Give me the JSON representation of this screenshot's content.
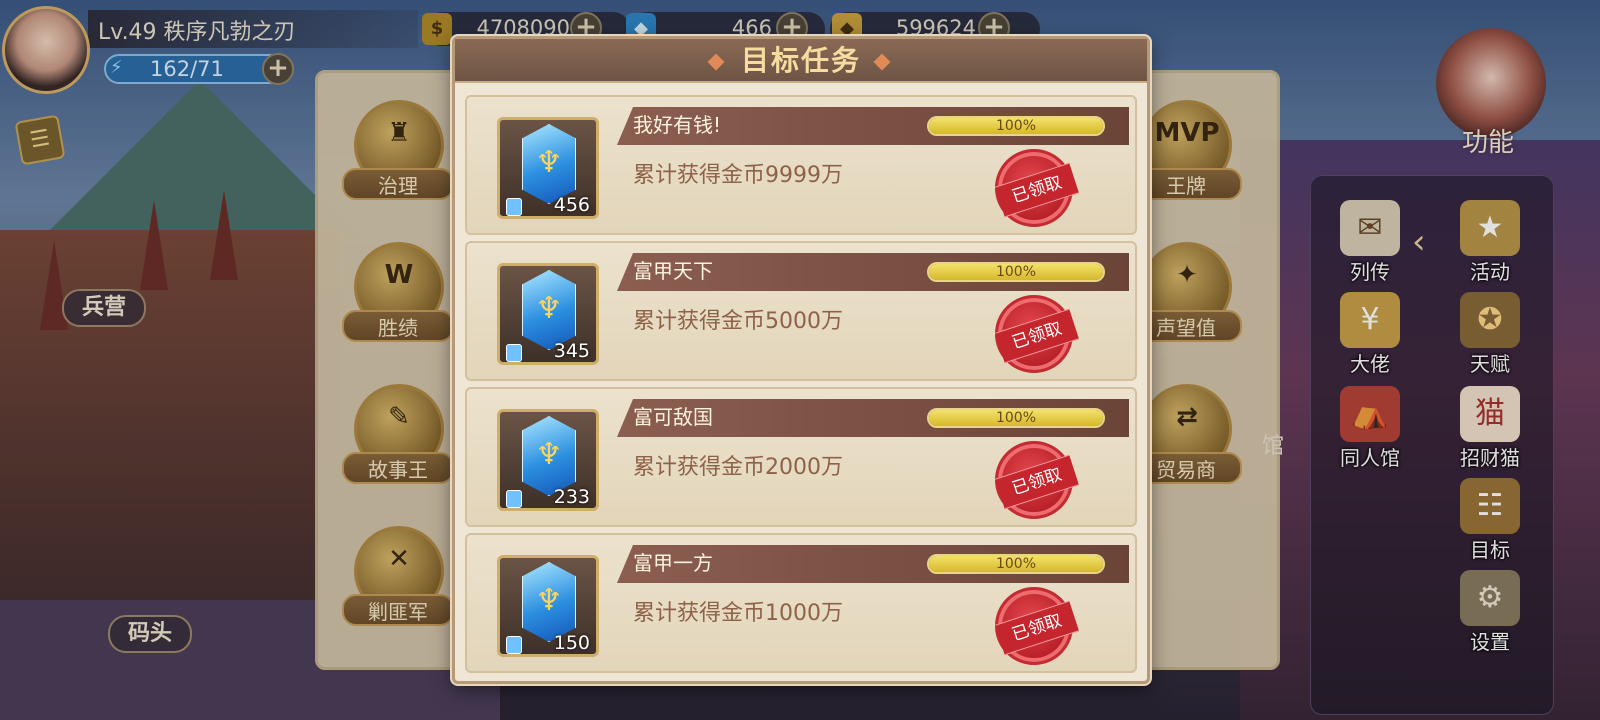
{
  "player": {
    "level_name": "Lv.49  秩序凡勃之刃",
    "energy": "162/71"
  },
  "resources": [
    {
      "icon": "gold-coin-icon",
      "value": "4708090"
    },
    {
      "icon": "blue-ticket-icon",
      "value": "466"
    },
    {
      "icon": "gold-ticket-icon",
      "value": "599624"
    }
  ],
  "places": {
    "barracks": "兵营",
    "dock": "码头"
  },
  "left_menu": [
    "治理",
    "胜绩",
    "故事王",
    "剿匪军"
  ],
  "right_menu": [
    "王牌",
    "声望值",
    "贸易商"
  ],
  "right_panel": {
    "function_label": "功能",
    "items": [
      "列传",
      "活动",
      "大佬",
      "天赋",
      "同人馆",
      "招财猫",
      "目标",
      "设置"
    ]
  },
  "side_fragment": "馆",
  "modal": {
    "title": "目标任务",
    "tasks": [
      {
        "title": "我好有钱!",
        "desc": "累计获得金币9999万",
        "progress": "100%",
        "progress_value": 1.0,
        "reward_amount": "456",
        "status": "已领取"
      },
      {
        "title": "富甲天下",
        "desc": "累计获得金币5000万",
        "progress": "100%",
        "progress_value": 1.0,
        "reward_amount": "345",
        "status": "已领取"
      },
      {
        "title": "富可敌国",
        "desc": "累计获得金币2000万",
        "progress": "100%",
        "progress_value": 1.0,
        "reward_amount": "233",
        "status": "已领取"
      },
      {
        "title": "富甲一方",
        "desc": "累计获得金币1000万",
        "progress": "100%",
        "progress_value": 1.0,
        "reward_amount": "150",
        "status": "已领取"
      }
    ]
  },
  "colors": {
    "modal_bg": "#efe6d5",
    "header_brown": "#6e5444",
    "title_gold": "#f6dca0",
    "progress_yellow": "#d6b92a",
    "stamp_red": "#b71f26"
  }
}
